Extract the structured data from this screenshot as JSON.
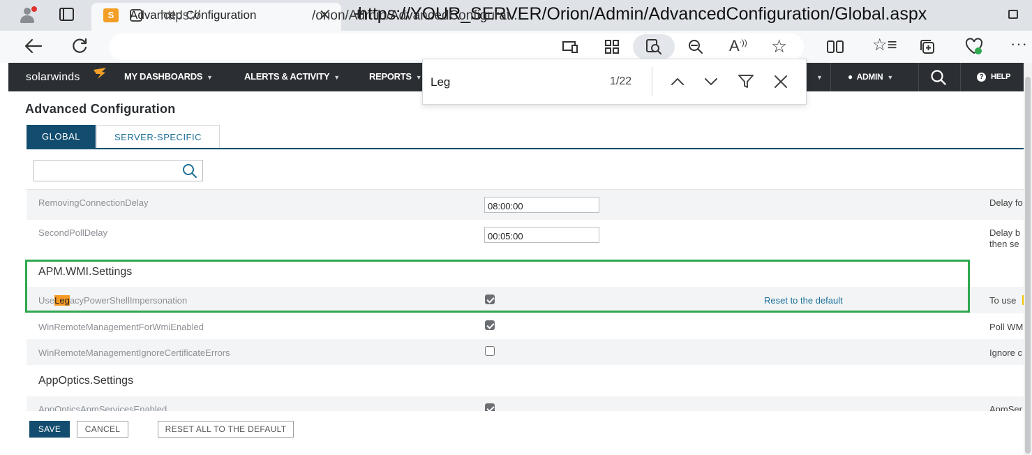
{
  "browser": {
    "tab_title": "Advanced Configuration",
    "tab_favicon_letter": "S",
    "url_overlay": "https://YOUR_SERVER/Orion/Admin/AdvancedConfiguration/Global.aspx",
    "url_prefix": "https://",
    "url_path": "/orion/Admin/AdvancedConfigurat...",
    "icons": [
      "back-icon",
      "refresh-icon",
      "lock-icon",
      "cast-icon",
      "apps-icon",
      "find-icon",
      "zoom-out-icon",
      "read-aloud-icon",
      "favorite-star-icon",
      "split-screen-icon",
      "favorites-icon",
      "collections-icon",
      "performance-icon",
      "more-icon"
    ]
  },
  "findbar": {
    "query": "Leg",
    "count": "1/22"
  },
  "nav": {
    "brand": "solarwinds",
    "items": [
      "MY DASHBOARDS",
      "ALERTS & ACTIVITY",
      "REPORTS"
    ],
    "admin": "ADMIN",
    "help": "HELP",
    "help_glyph": "?"
  },
  "page": {
    "title": "Advanced Configuration",
    "tabs": [
      "GLOBAL",
      "SERVER-SPECIFIC"
    ],
    "search_value": ""
  },
  "rows": [
    {
      "name": "RemovingConnectionDelay",
      "value": "08:00:00",
      "desc": "Delay fo"
    },
    {
      "name": "SecondPollDelay",
      "value": "00:05:00",
      "desc_line1": "Delay b",
      "desc_line2": "then se"
    },
    {
      "section": "APM.WMI.Settings"
    },
    {
      "name_pre": "Use",
      "name_hl": "Leg",
      "name_post": "acyPowerShellImpersonation",
      "checked": true,
      "reset": "Reset to the default",
      "desc": "To use"
    },
    {
      "name": "WinRemoteManagementForWmiEnabled",
      "checked": true,
      "desc": "Poll WM"
    },
    {
      "name": "WinRemoteManagementIgnoreCertificateErrors",
      "checked": false,
      "desc": "Ignore c"
    },
    {
      "section": "AppOptics.Settings"
    },
    {
      "name": "AppOpticsApmServicesEnabled",
      "checked": true,
      "desc": "ApmSer"
    }
  ],
  "buttons": {
    "save": "SAVE",
    "cancel": "CANCEL",
    "reset_all": "RESET ALL TO THE DEFAULT"
  }
}
